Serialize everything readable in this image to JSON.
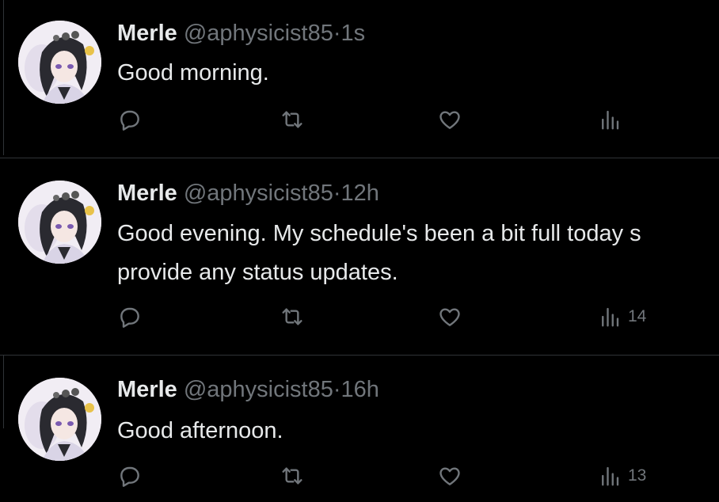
{
  "tweets": [
    {
      "display_name": "Merle",
      "handle": "@aphysicist85",
      "separator": "·",
      "time": "1s",
      "text": "Good morning.",
      "actions": {
        "reply_icon": "reply-icon",
        "retweet_icon": "retweet-icon",
        "like_icon": "like-icon",
        "views_icon": "views-icon",
        "views_count": ""
      }
    },
    {
      "display_name": "Merle",
      "handle": "@aphysicist85",
      "separator": "·",
      "time": "12h",
      "text": "Good evening. My schedule's been a bit full today s\nprovide any status updates.",
      "actions": {
        "reply_icon": "reply-icon",
        "retweet_icon": "retweet-icon",
        "like_icon": "like-icon",
        "views_icon": "views-icon",
        "views_count": "14"
      }
    },
    {
      "display_name": "Merle",
      "handle": "@aphysicist85",
      "separator": "·",
      "time": "16h",
      "text": "Good afternoon.",
      "actions": {
        "reply_icon": "reply-icon",
        "retweet_icon": "retweet-icon",
        "like_icon": "like-icon",
        "views_icon": "views-icon",
        "views_count": "13"
      }
    }
  ],
  "colors": {
    "background": "#000000",
    "primary_text": "#e7e9ea",
    "secondary_text": "#71767b",
    "divider": "#2f3336"
  }
}
